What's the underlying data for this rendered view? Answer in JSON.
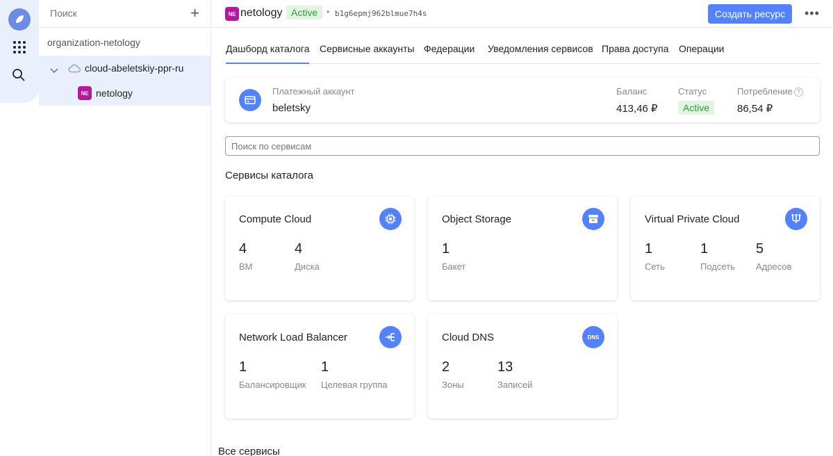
{
  "rail": {
    "icons": [
      "logo-icon",
      "apps-grid-icon",
      "search-icon"
    ]
  },
  "tree": {
    "search_placeholder": "Поиск",
    "organization": "organization-netology",
    "cloud": "cloud-abeletskiy-ppr-ru",
    "folder_badge": "NE",
    "folder": "netology"
  },
  "topbar": {
    "badge": "NE",
    "name": "netology",
    "status": "Active",
    "separator": "•",
    "folder_id": "b1g6epmj962blmue7h4s",
    "create_button": "Создать ресурс",
    "more": "•••"
  },
  "tabs": [
    {
      "label": "Дашборд каталога",
      "active": true
    },
    {
      "label": "Сервисные аккаунты",
      "active": false
    },
    {
      "label": "Федерации",
      "active": false
    },
    {
      "label": "Уведомления сервисов",
      "active": false
    },
    {
      "label": "Права доступа",
      "active": false
    },
    {
      "label": "Операции",
      "active": false
    }
  ],
  "billing": {
    "account_label": "Платежный аккаунт",
    "account_name": "beletsky",
    "balance_label": "Баланс",
    "balance_value": "413,46 ₽",
    "status_label": "Статус",
    "status_value": "Active",
    "consumption_label": "Потребление",
    "consumption_help": "?",
    "consumption_value": "86,54 ₽"
  },
  "service_search": {
    "placeholder": "Поиск по сервисам"
  },
  "section_title": "Сервисы каталога",
  "cards": [
    {
      "title": "Compute Cloud",
      "icon": "compute-icon",
      "stats": [
        {
          "num": "4",
          "label": "ВМ"
        },
        {
          "num": "4",
          "label": "Диска"
        }
      ]
    },
    {
      "title": "Object Storage",
      "icon": "storage-icon",
      "stats": [
        {
          "num": "1",
          "label": "Бакет"
        }
      ]
    },
    {
      "title": "Virtual Private Cloud",
      "icon": "network-icon",
      "stats": [
        {
          "num": "1",
          "label": "Сеть"
        },
        {
          "num": "1",
          "label": "Подсеть"
        },
        {
          "num": "5",
          "label": "Адресов"
        }
      ]
    },
    {
      "title": "Network Load Balancer",
      "icon": "balancer-icon",
      "stats": [
        {
          "num": "1",
          "label": "Балансировщик"
        },
        {
          "num": "1",
          "label": "Целевая группа"
        }
      ]
    },
    {
      "title": "Cloud DNS",
      "icon": "dns-icon",
      "icon_text": "DNS",
      "stats": [
        {
          "num": "2",
          "label": "Зоны"
        },
        {
          "num": "13",
          "label": "Записей"
        }
      ]
    }
  ],
  "all_services": "Все сервисы",
  "colors": {
    "accent": "#5282ff",
    "active_bg": "#e3f5e1",
    "active_text": "#2e9c3c",
    "folder_badge": "#b5179e"
  }
}
